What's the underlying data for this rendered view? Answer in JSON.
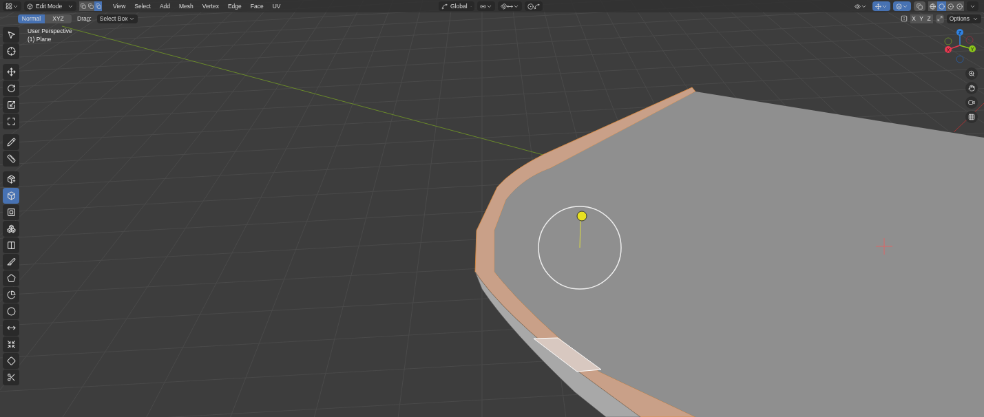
{
  "header": {
    "mode": "Edit Mode",
    "select_modes": [
      {
        "selected": false
      },
      {
        "selected": false
      },
      {
        "selected": true
      }
    ],
    "menus": [
      "View",
      "Select",
      "Add",
      "Mesh",
      "Vertex",
      "Edge",
      "Face",
      "UV"
    ],
    "orientation": "Global",
    "overlays_on": true,
    "gizmos_on": true,
    "xray_on": false,
    "shading": [
      {
        "selected": false
      },
      {
        "selected": true
      },
      {
        "selected": false
      },
      {
        "selected": false
      }
    ]
  },
  "tool_settings": {
    "orient": [
      {
        "label": "Normal",
        "selected": true
      },
      {
        "label": "XYZ",
        "selected": false
      }
    ],
    "drag_label": "Drag:",
    "drag_value": "Select Box",
    "mirror_axes": [
      {
        "label": "X",
        "on": false
      },
      {
        "label": "Y",
        "on": false
      },
      {
        "label": "Z",
        "on": false
      }
    ],
    "options": "Options"
  },
  "viewport": {
    "view_name": "User Perspective",
    "object_name": "(1) Plane",
    "gizmo": {
      "z": "Z",
      "x": "X",
      "y": "Y"
    }
  },
  "toolbar": {
    "groups": [
      {
        "tools": [
          {
            "selected": false
          },
          {
            "selected": false
          }
        ]
      },
      {
        "tools": [
          {
            "selected": false
          },
          {
            "selected": false
          },
          {
            "selected": false
          },
          {
            "selected": false
          }
        ]
      },
      {
        "tools": [
          {
            "selected": false
          },
          {
            "selected": false
          }
        ]
      },
      {
        "tools": [
          {
            "selected": false
          },
          {
            "selected": true
          },
          {
            "selected": false
          },
          {
            "selected": false
          },
          {
            "selected": false
          },
          {
            "selected": false
          },
          {
            "selected": false
          },
          {
            "selected": false
          },
          {
            "selected": false
          },
          {
            "selected": false
          },
          {
            "selected": false
          },
          {
            "selected": false
          },
          {
            "selected": false
          }
        ]
      }
    ]
  }
}
